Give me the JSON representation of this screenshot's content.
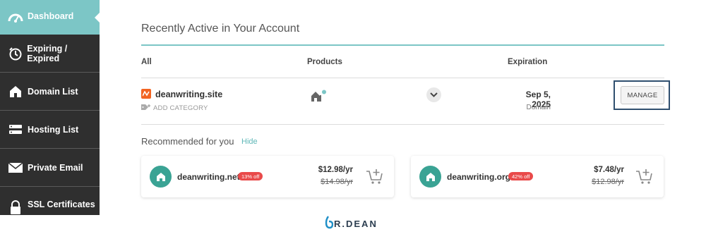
{
  "sidebar": {
    "items": [
      {
        "label": "Dashboard",
        "icon": "speedometer-icon",
        "active": true
      },
      {
        "label": "Expiring / Expired",
        "icon": "clock-icon"
      },
      {
        "label": "Domain List",
        "icon": "house-icon"
      },
      {
        "label": "Hosting List",
        "icon": "server-icon"
      },
      {
        "label": "Private Email",
        "icon": "envelope-icon"
      },
      {
        "label": "SSL Certificates",
        "icon": "lock-icon"
      }
    ]
  },
  "main": {
    "title": "Recently Active in Your Account",
    "columns": {
      "all": "All",
      "products": "Products",
      "expiration": "Expiration"
    },
    "domain": {
      "name": "deanwriting.site",
      "add_category": "ADD CATEGORY",
      "expiration_date": "Sep 5, 2025",
      "expiration_type": "Domain",
      "manage_label": "MANAGE"
    },
    "recommended": {
      "title": "Recommended for you",
      "hide_label": "Hide",
      "cards": [
        {
          "domain": "deanwriting.net",
          "badge": "13% off",
          "price": "$12.98/yr",
          "old_price": "$14.98/yr"
        },
        {
          "domain": "deanwriting.org",
          "badge": "42% off",
          "price": "$7.48/yr",
          "old_price": "$12.98/yr"
        }
      ]
    }
  },
  "footer": {
    "logo_text": "R.DEAN"
  },
  "colors": {
    "accent": "#7cc6c6",
    "sidebar_bg": "#2f2f2f",
    "badge": "#e94a4a",
    "brand_orange": "#f26422",
    "card_icon": "#3aa394"
  }
}
